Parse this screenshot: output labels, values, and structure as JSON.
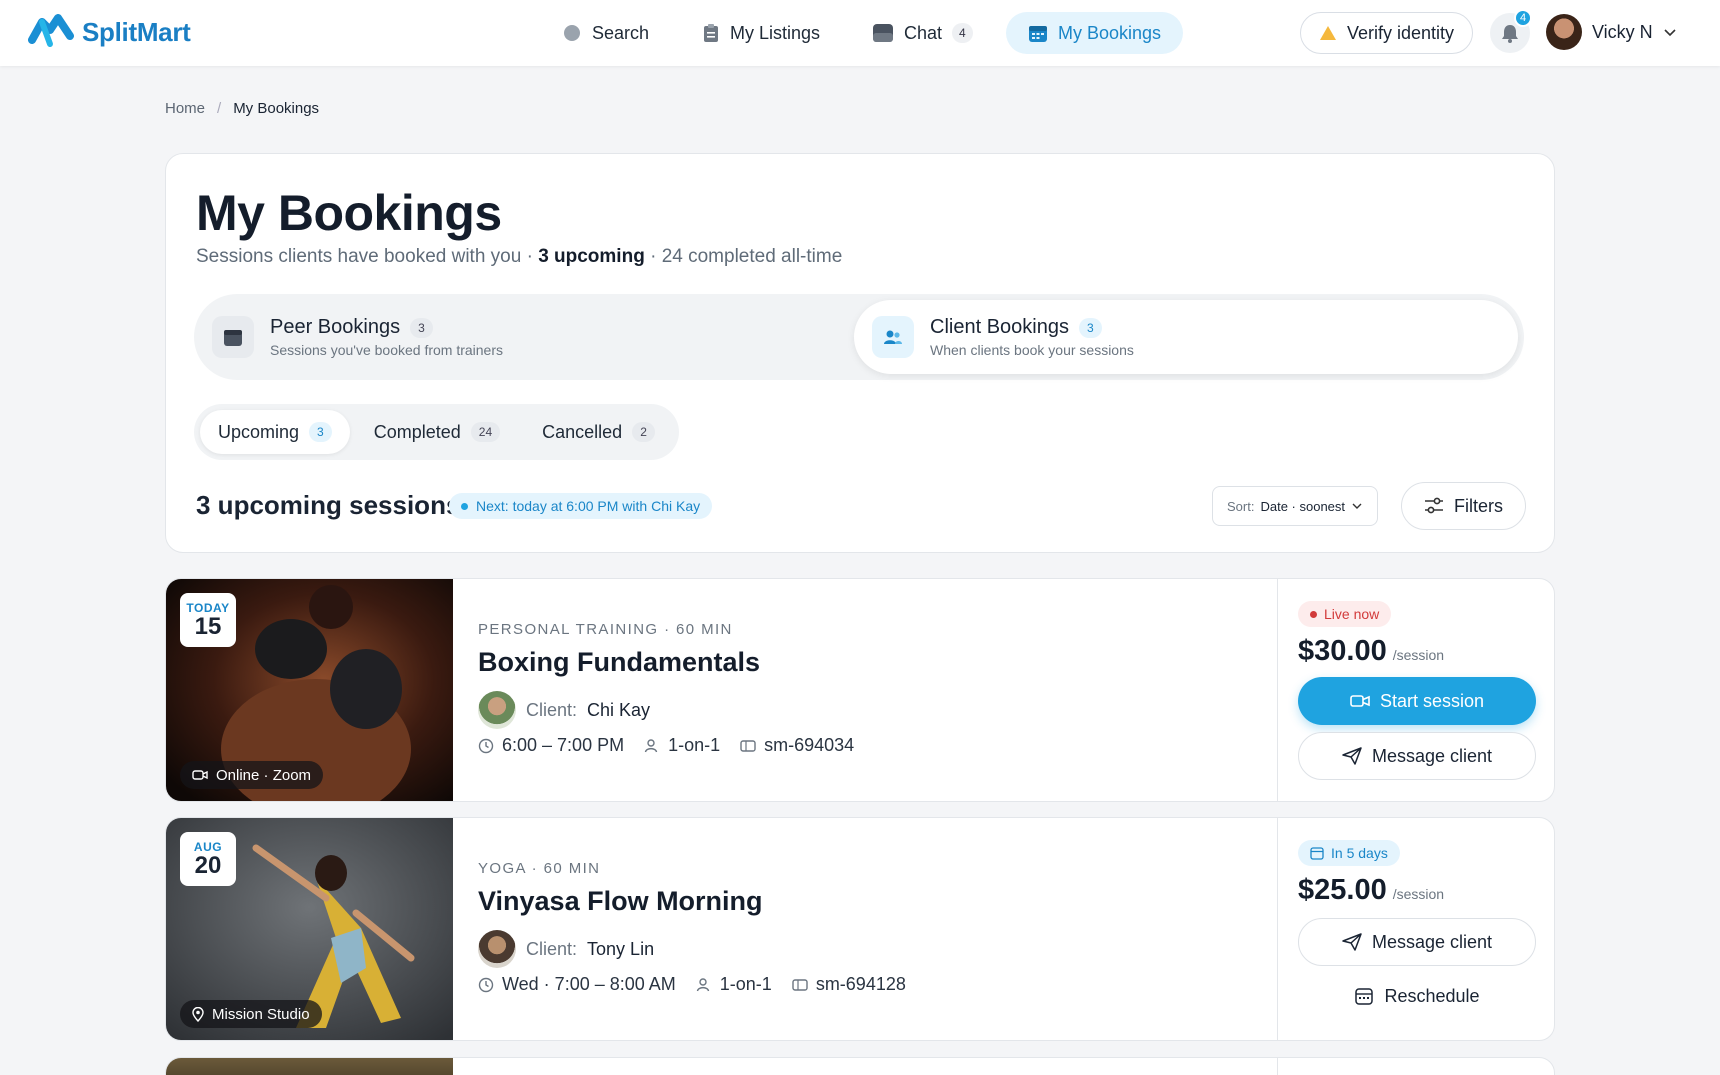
{
  "brand": {
    "name": "SplitMart"
  },
  "nav": {
    "search": "Search",
    "listings": "My Listings",
    "chat": "Chat",
    "chat_count": "4",
    "bookings": "My Bookings"
  },
  "header": {
    "verify": "Verify identity",
    "notifications": "4",
    "user": "Vicky N"
  },
  "breadcrumb": {
    "home": "Home",
    "current": "My Bookings"
  },
  "page": {
    "title": "My Bookings",
    "subtitle_start": "Sessions clients have booked with you · ",
    "subtitle_bold": "3 upcoming",
    "subtitle_end": " · 24 completed all-time"
  },
  "segments": {
    "peer": {
      "title": "Peer Bookings",
      "count": "3",
      "desc": "Sessions you've booked from trainers"
    },
    "client": {
      "title": "Client Bookings",
      "count": "3",
      "desc": "When clients book your sessions"
    }
  },
  "tabs": [
    {
      "label": "Upcoming",
      "count": "3"
    },
    {
      "label": "Completed",
      "count": "24"
    },
    {
      "label": "Cancelled",
      "count": "2"
    }
  ],
  "list": {
    "heading": "3 upcoming sessions",
    "next": "Next: today at 6:00 PM with Chi Kay",
    "sort_label": "Sort:",
    "sort_value": "Date · soonest",
    "filters": "Filters"
  },
  "bookings": [
    {
      "month": "TODAY",
      "day": "15",
      "location": "Online · Zoom",
      "category": "PERSONAL TRAINING · 60 MIN",
      "title": "Boxing Fundamentals",
      "client_label": "Client:",
      "client": "Chi Kay",
      "time": "6:00 – 7:00 PM",
      "format": "1-on-1",
      "id": "sm-694034",
      "status": "Live now",
      "price": "$30.00",
      "unit": "/session",
      "primary": "Start session",
      "secondary": "Message client"
    },
    {
      "month": "AUG",
      "day": "20",
      "location": "Mission Studio",
      "category": "YOGA · 60 MIN",
      "title": "Vinyasa Flow Morning",
      "client_label": "Client:",
      "client": "Tony Lin",
      "time": "Wed · 7:00 – 8:00 AM",
      "format": "1-on-1",
      "id": "sm-694128",
      "status": "In 5 days",
      "price": "$25.00",
      "unit": "/session",
      "primary": "Message client",
      "secondary": "Reschedule"
    }
  ],
  "colors": {
    "accent": "#1fa3e0",
    "live": "#d23a3a",
    "text": "#141d2b"
  }
}
